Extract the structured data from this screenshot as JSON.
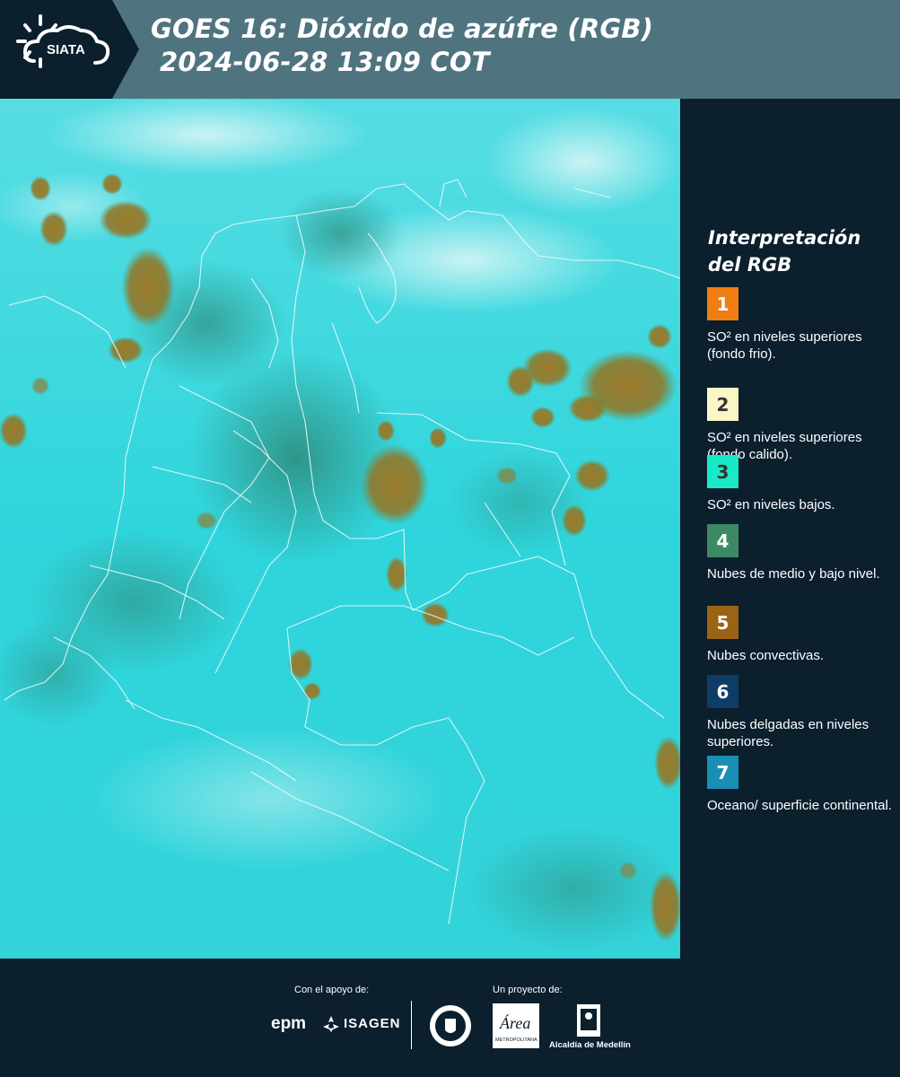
{
  "header": {
    "logo_text": "SIATA",
    "title_line1": "GOES 16: Dióxido de azúfre (RGB)",
    "title_line2": "2024-06-28 13:09 COT",
    "background_color": "#4f7480",
    "logo_panel_color": "#0b1f2d"
  },
  "map": {
    "icon": "satellite-map-image",
    "background_color": "#33d6dd"
  },
  "legend": {
    "title_line1": "Interpretación",
    "title_line2": "del RGB",
    "items": [
      {
        "number": "1",
        "color": "#f07e12",
        "text_color": "#ffffff",
        "label": "SO² en niveles superiores (fondo frio)."
      },
      {
        "number": "2",
        "color": "#fbf6c5",
        "text_color": "#333333",
        "label": "SO² en niveles superiores (fondo calido)."
      },
      {
        "number": "3",
        "color": "#18eac7",
        "text_color": "#333333",
        "label": "SO² en niveles bajos."
      },
      {
        "number": "4",
        "color": "#3c8a64",
        "text_color": "#ffffff",
        "label": "Nubes de medio y bajo nivel."
      },
      {
        "number": "5",
        "color": "#9a6414",
        "text_color": "#ffffff",
        "label": "Nubes convectivas."
      },
      {
        "number": "6",
        "color": "#0e3c66",
        "text_color": "#ffffff",
        "label": "Nubes delgadas en niveles superiores."
      },
      {
        "number": "7",
        "color": "#1a8fb6",
        "text_color": "#ffffff",
        "label": "Oceano/ superficie continental."
      }
    ]
  },
  "footer": {
    "support_label": "Con el apoyo de:",
    "project_label": "Un proyecto de:",
    "sponsor1": "epm",
    "sponsor2": "ISAGEN",
    "partner_area": "Área",
    "partner_area_sub": "METROPOLITANA",
    "partner_alcaldia": "Alcaldía de Medellín"
  }
}
